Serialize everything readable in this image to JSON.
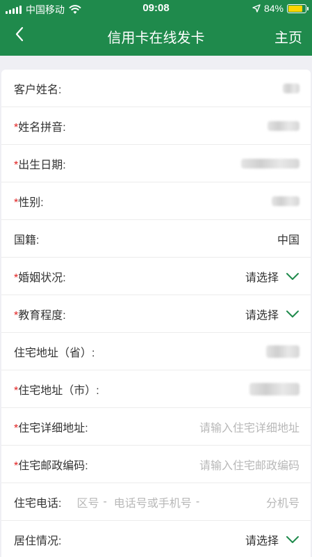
{
  "status_bar": {
    "carrier": "中国移动",
    "time": "09:08",
    "battery": "84%",
    "battery_level": 0.84
  },
  "nav": {
    "title": "信用卡在线发卡",
    "home_label": "主页"
  },
  "form": {
    "customer_name": {
      "label": "客户姓名:"
    },
    "name_pinyin": {
      "required": "*",
      "label": "姓名拼音:"
    },
    "birth_date": {
      "required": "*",
      "label": "出生日期:"
    },
    "gender": {
      "required": "*",
      "label": "性别:"
    },
    "nationality": {
      "label": "国籍:",
      "value": "中国"
    },
    "marital_status": {
      "required": "*",
      "label": "婚姻状况:",
      "value": "请选择"
    },
    "education": {
      "required": "*",
      "label": "教育程度:",
      "value": "请选择"
    },
    "address_province": {
      "label": "住宅地址（省）:"
    },
    "address_city": {
      "required": "*",
      "label": "住宅地址（市）:"
    },
    "address_detail": {
      "required": "*",
      "label": "住宅详细地址:",
      "placeholder": "请输入住宅详细地址"
    },
    "postal_code": {
      "required": "*",
      "label": "住宅邮政编码:",
      "placeholder": "请输入住宅邮政编码"
    },
    "home_phone": {
      "label": "住宅电话:",
      "area_placeholder": "区号",
      "number_placeholder": "电话号或手机号",
      "ext_placeholder": "分机号",
      "separator": "-"
    },
    "residence": {
      "label": "居住情况:",
      "value": "请选择"
    }
  },
  "colors": {
    "header_green": "#1f8a4c",
    "chevron_green": "#1f8a4c",
    "required_red": "#e02020",
    "battery_yellow": "#ffd400"
  }
}
